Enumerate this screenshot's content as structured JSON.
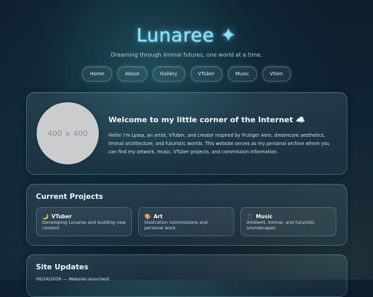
{
  "site": {
    "title": "Lunaree ✦",
    "tagline": "Dreaming through liminal futures, one world at a time."
  },
  "nav": {
    "items": [
      "Home",
      "About",
      "Gallery",
      "VTuber",
      "Music",
      "VGen"
    ]
  },
  "hero": {
    "avatar_placeholder": "400 × 400",
    "heading": "Welcome to my little corner of the Internet ☁️",
    "body": "Hello! I'm Lyssa, an artist, VTuber, and creator inspired by Frutiger Aero, dreamcore aesthetics, liminal architecture, and futuristic worlds. This website serves as my personal archive where you can find my artwork, music, VTuber projects, and commission information."
  },
  "projects": {
    "title": "Current Projects",
    "cards": [
      {
        "icon": "🌙",
        "icon_name": "moon-icon",
        "title": "VTuber",
        "desc": "Developing Lunaree and building new content."
      },
      {
        "icon": "🎨",
        "icon_name": "palette-icon",
        "title": "Art",
        "desc": "Illustration commissions and personal work."
      },
      {
        "icon": "🎵",
        "icon_name": "music-note-icon",
        "title": "Music",
        "desc": "Ambient, liminal, and futuristic soundscapes."
      }
    ]
  },
  "updates": {
    "title": "Site Updates",
    "entries": [
      "06/24/2026 — Website launched!"
    ]
  }
}
